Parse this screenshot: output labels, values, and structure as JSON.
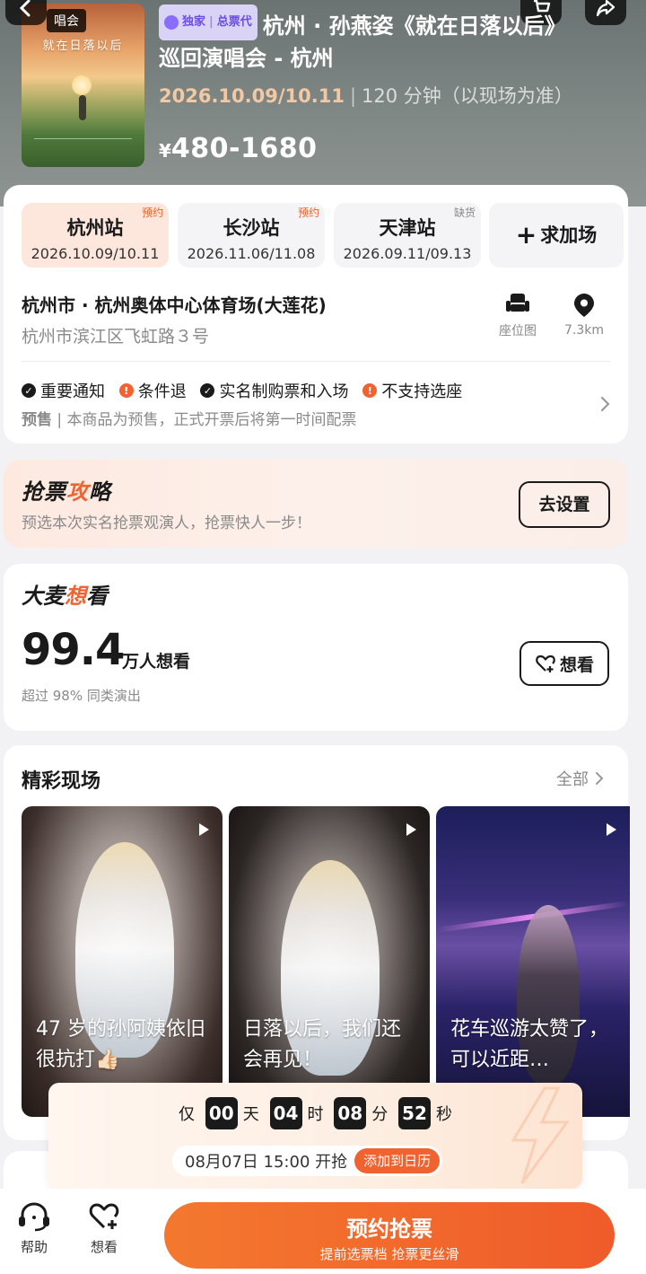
{
  "header": {
    "poster_tag": "唱会",
    "poster_title": "就在日落以后",
    "badge_exclusive": "独家",
    "badge_agent": "总票代",
    "title_line1": "杭州 · 孙燕姿《就在日落以后》",
    "title_line2": "巡回演唱会 - 杭州",
    "date": "2026.10.09/10.11",
    "duration": "120 分钟（以现场为准）",
    "price_currency": "¥",
    "price_range": "480-1680"
  },
  "stations": [
    {
      "name": "杭州站",
      "dates": "2026.10.09/10.11",
      "flag": "预约"
    },
    {
      "name": "长沙站",
      "dates": "2026.11.06/11.08",
      "flag": "预约"
    },
    {
      "name": "天津站",
      "dates": "2026.09.11/09.13",
      "flag": "缺货"
    }
  ],
  "add_station_label": "求加场",
  "venue": {
    "name": "杭州市 · 杭州奥体中心体育场(大莲花)",
    "address": "杭州市滨江区飞虹路３号",
    "seatmap_label": "座位图",
    "distance": "7.3km"
  },
  "notices": {
    "items": [
      "重要通知",
      "条件退",
      "实名制购票和入场",
      "不支持选座"
    ],
    "presale_tag": "预售",
    "presale_text": "本商品为预售，正式开票后将第一时间配票"
  },
  "strategy": {
    "title_a": "抢票",
    "title_b": "攻",
    "title_c": "略",
    "desc": "预选本次实名抢票观演人，抢票快人一步！",
    "button": "去设置"
  },
  "want": {
    "title_a": "大麦",
    "title_b": "想",
    "title_c": "看",
    "count": "99.4",
    "unit": "万人想看",
    "sub": "超过 98% 同类演出",
    "button": "想看"
  },
  "live": {
    "title": "精彩现场",
    "more": "全部",
    "videos": [
      {
        "caption": "47 岁的孙阿姨依旧很抗打👍🏻"
      },
      {
        "caption": "日落以后，我们还会再见！"
      },
      {
        "caption": "花车巡游太赞了，可以近距…"
      }
    ]
  },
  "countdown": {
    "prefix": "仅",
    "days": "00",
    "day_label": "天",
    "hours": "04",
    "hour_label": "时",
    "minutes": "08",
    "minute_label": "分",
    "seconds": "52",
    "second_label": "秒",
    "open_time": "08月07日 15:00 开抢",
    "add_calendar": "添加到日历"
  },
  "bottom": {
    "help": "帮助",
    "want": "想看",
    "cta_main": "预约抢票",
    "cta_sub": "提前选票档 抢票更丝滑"
  },
  "colors": {
    "accent": "#f0622f",
    "badge_purple": "#6b4de6"
  }
}
